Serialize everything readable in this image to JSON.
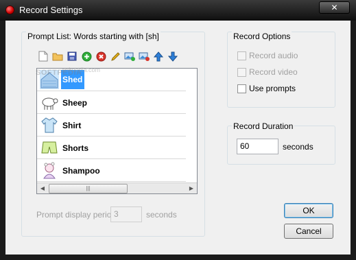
{
  "window": {
    "title": "Record Settings",
    "close_label": "✕"
  },
  "prompt_list": {
    "legend": "Prompt List: Words starting with [sh]",
    "toolbar": [
      {
        "name": "new-icon",
        "color": "#ffffff"
      },
      {
        "name": "open-folder-icon",
        "color": "#e8b64a"
      },
      {
        "name": "save-icon",
        "color": "#4a5fb5"
      },
      {
        "name": "add-icon",
        "color": "#2fae3a"
      },
      {
        "name": "remove-icon",
        "color": "#d9342b"
      },
      {
        "name": "edit-pencil-icon",
        "color": "#e7b21b"
      },
      {
        "name": "image-add-icon",
        "color": "#3d8bd6"
      },
      {
        "name": "image-remove-icon",
        "color": "#3d8bd6"
      },
      {
        "name": "move-up-icon",
        "color": "#2d7fd8"
      },
      {
        "name": "move-down-icon",
        "color": "#2d7fd8"
      }
    ],
    "items": [
      {
        "label": "Shed",
        "selected": true
      },
      {
        "label": "Sheep",
        "selected": false
      },
      {
        "label": "Shirt",
        "selected": false
      },
      {
        "label": "Shorts",
        "selected": false
      },
      {
        "label": "Shampoo",
        "selected": false
      }
    ],
    "watermark": "SOFTPEDIA",
    "watermark_small": "softpedia.com",
    "display_period_label": "Prompt display period:",
    "display_period_value": "3",
    "display_period_unit": "seconds"
  },
  "record_options": {
    "legend": "Record Options",
    "options": [
      {
        "label": "Record audio",
        "checked": false,
        "enabled": false
      },
      {
        "label": "Record video",
        "checked": false,
        "enabled": false
      },
      {
        "label": "Use prompts",
        "checked": false,
        "enabled": true
      }
    ]
  },
  "record_duration": {
    "legend": "Record Duration",
    "value": "60",
    "unit": "seconds"
  },
  "buttons": {
    "ok": "OK",
    "cancel": "Cancel"
  },
  "colors": {
    "selection": "#3399ff",
    "title_bar": "#1b1b1b"
  }
}
